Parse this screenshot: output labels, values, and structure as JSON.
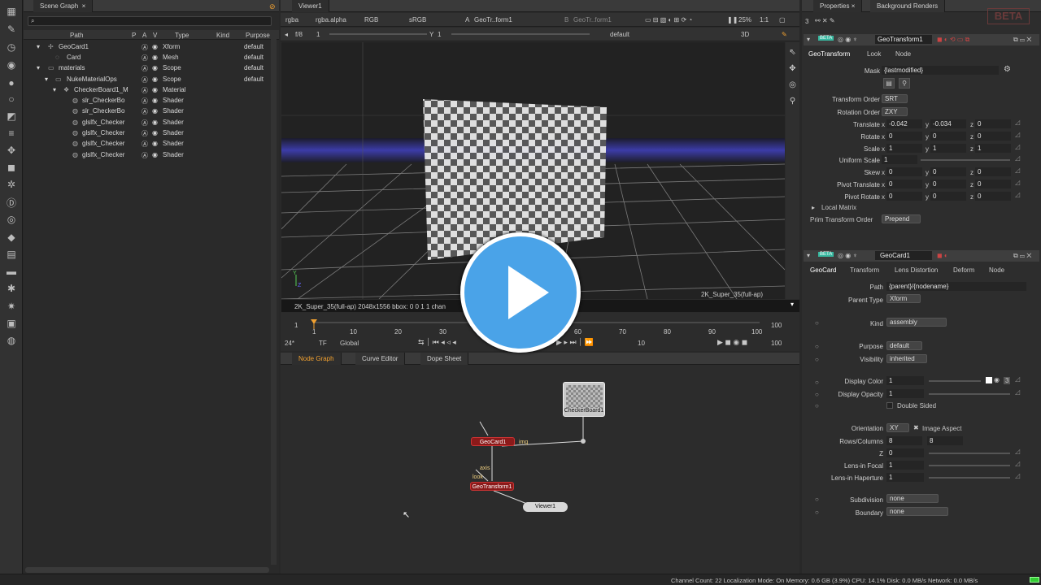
{
  "scene_graph": {
    "tab": "Scene Graph",
    "columns": {
      "path": "Path",
      "p": "P",
      "a": "A",
      "v": "V",
      "type": "Type",
      "kind": "Kind",
      "purpose": "Purpose"
    },
    "rows": [
      {
        "name": "GeoCard1",
        "type": "Xform",
        "purpose": "default"
      },
      {
        "name": "Card",
        "type": "Mesh",
        "purpose": "default"
      },
      {
        "name": "materials",
        "type": "Scope",
        "purpose": "default"
      },
      {
        "name": "NukeMaterialOps",
        "type": "Scope",
        "purpose": "default"
      },
      {
        "name": "CheckerBoard1_M",
        "type": "Material",
        "purpose": ""
      },
      {
        "name": "slr_CheckerBo",
        "type": "Shader",
        "purpose": ""
      },
      {
        "name": "slr_CheckerBo",
        "type": "Shader",
        "purpose": ""
      },
      {
        "name": "glslfx_Checker",
        "type": "Shader",
        "purpose": ""
      },
      {
        "name": "glslfx_Checker",
        "type": "Shader",
        "purpose": ""
      },
      {
        "name": "glslfx_Checker",
        "type": "Shader",
        "purpose": ""
      },
      {
        "name": "glslfx_Checker",
        "type": "Shader",
        "purpose": ""
      }
    ]
  },
  "viewer": {
    "tab": "Viewer1",
    "channels": "rgba",
    "alpha": "rgba.alpha",
    "mode": "RGB",
    "lut": "sRGB",
    "input_a": "GeoTr..form1",
    "input_b": "GeoTr..form1",
    "zoom": "25%",
    "ratio": "1:1",
    "fstop": "f/8",
    "gain": "1",
    "gamma": "1",
    "camera": "default",
    "view_mode": "3D",
    "format_label": "2K_Super_35(full-ap)",
    "info": "2K_Super_35(full-ap) 2048x1556  bbox: 0 0 1 1 chan",
    "axis_y": "Y",
    "axis_z": "Z"
  },
  "timeline": {
    "ticks": [
      "1",
      "10",
      "20",
      "30",
      "60",
      "70",
      "80",
      "90",
      "100"
    ],
    "start": "1",
    "end": "100",
    "fps": "24*",
    "tf": "TF",
    "global": "Global",
    "step": "10",
    "frame_end": "100"
  },
  "node_graph": {
    "tabs": [
      "Node Graph",
      "Curve Editor",
      "Dope Sheet"
    ],
    "nodes": {
      "checker": "CheckerBoard1",
      "geocard": "GeoCard1",
      "geotransform": "GeoTransform1",
      "viewer": "Viewer1"
    },
    "labels": {
      "img": "img",
      "axis": "axis",
      "look": "look"
    }
  },
  "properties": {
    "tabs": [
      "Properties",
      "Background Renders"
    ],
    "beta": "BETA",
    "count": "3",
    "geotransform": {
      "badge": "BETA",
      "name": "GeoTransform1",
      "tabs": [
        "GeoTransform",
        "Look",
        "Node"
      ],
      "mask_label": "Mask",
      "mask_value": "{lastmodified}",
      "transform_order_label": "Transform Order",
      "transform_order": "SRT",
      "rotation_order_label": "Rotation Order",
      "rotation_order": "ZXY",
      "rows": [
        {
          "label": "Translate",
          "x": "-0.042",
          "y": "-0.034",
          "z": "0"
        },
        {
          "label": "Rotate",
          "x": "0",
          "y": "0",
          "z": "0"
        },
        {
          "label": "Scale",
          "x": "1",
          "y": "1",
          "z": "1"
        },
        {
          "label": "Skew",
          "x": "0",
          "y": "0",
          "z": "0"
        },
        {
          "label": "Pivot Translate",
          "x": "0",
          "y": "0",
          "z": "0"
        },
        {
          "label": "Pivot Rotate",
          "x": "0",
          "y": "0",
          "z": "0"
        }
      ],
      "uniform_scale_label": "Uniform Scale",
      "uniform_scale": "1",
      "local_matrix": "Local Matrix",
      "prim_order_label": "Prim Transform Order",
      "prim_order": "Prepend",
      "axis": {
        "x": "x",
        "y": "y",
        "z": "z"
      }
    },
    "geocard": {
      "badge": "BETA",
      "name": "GeoCard1",
      "tabs": [
        "GeoCard",
        "Transform",
        "Lens Distortion",
        "Deform",
        "Node"
      ],
      "path_label": "Path",
      "path_value": "{parent}/{nodename}",
      "parent_type_label": "Parent Type",
      "parent_type": "Xform",
      "kind_label": "Kind",
      "kind": "assembly",
      "purpose_label": "Purpose",
      "purpose": "default",
      "visibility_label": "Visibility",
      "visibility": "inherited",
      "display_color_label": "Display Color",
      "display_color": "1",
      "display_color_count": "3",
      "display_opacity_label": "Display Opacity",
      "display_opacity": "1",
      "double_sided": "Double Sided",
      "orientation_label": "Orientation",
      "orientation": "XY",
      "image_aspect": "Image Aspect",
      "rows_cols_label": "Rows/Columns",
      "rows": "8",
      "cols": "8",
      "z_label": "Z",
      "z": "0",
      "lens_focal_label": "Lens-in Focal",
      "lens_focal": "1",
      "lens_haperture_label": "Lens-in Haperture",
      "lens_haperture": "1",
      "subdivision_label": "Subdivision",
      "subdivision": "none",
      "boundary_label": "Boundary",
      "boundary": "none"
    }
  },
  "status": "Channel Count: 22  Localization Mode: On  Memory: 0.6 GB (3.9%)  CPU: 14.1%  Disk: 0.0 MB/s  Network: 0.0 MB/s",
  "colors": {
    "accent": "#f0a030",
    "node_red": "#8b1a1a",
    "play_blue": "#4aa3e8",
    "beta_green": "#38b8a0"
  }
}
